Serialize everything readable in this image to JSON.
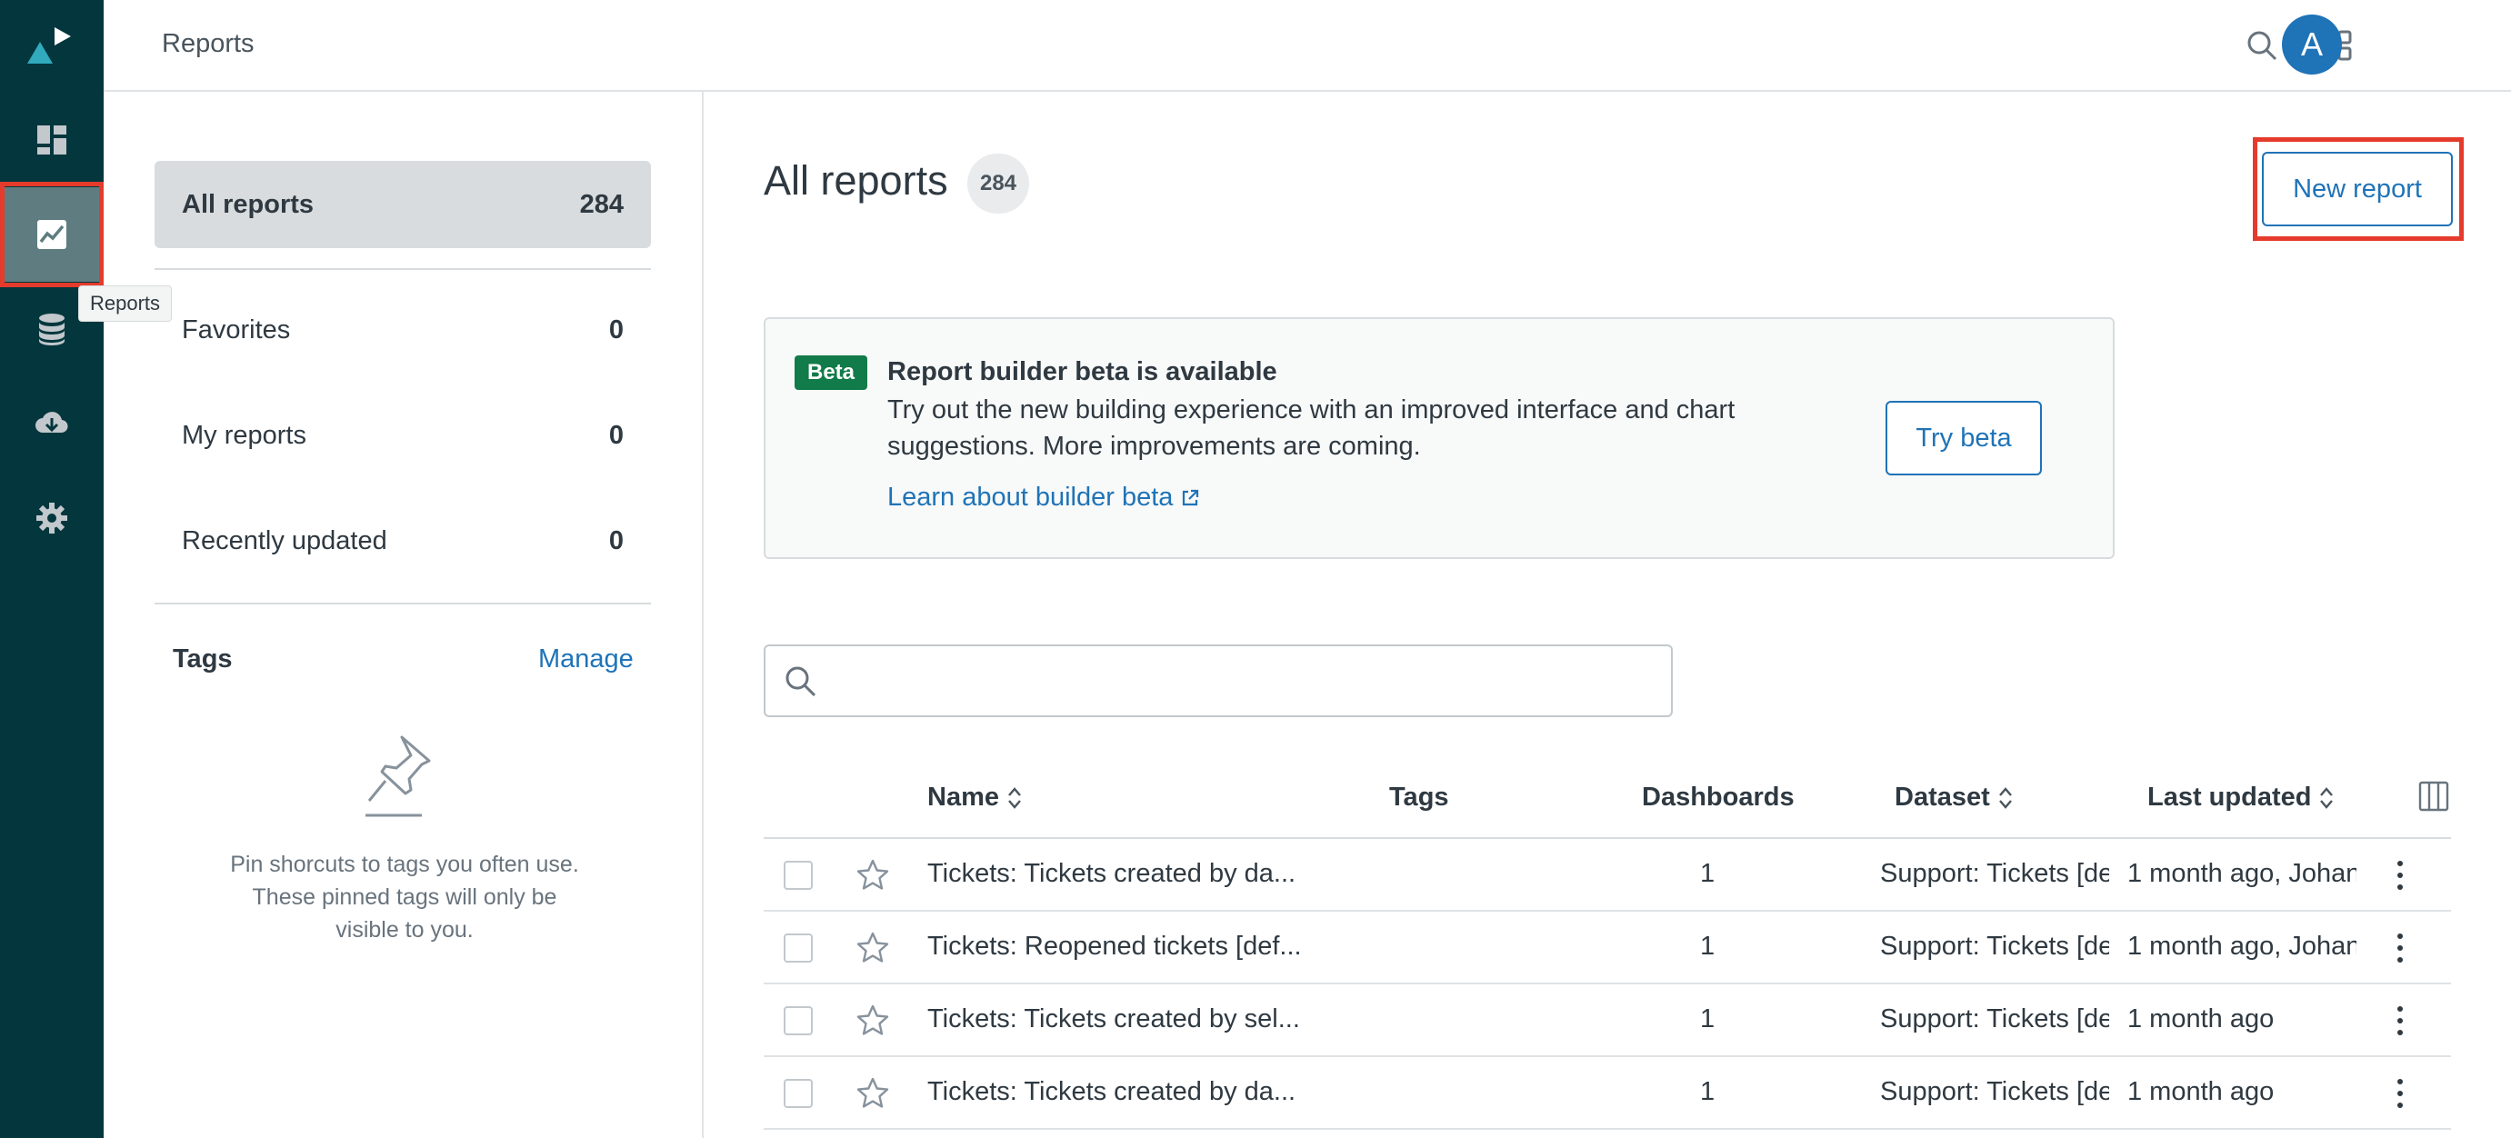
{
  "header": {
    "title": "Reports",
    "avatar_initial": "A"
  },
  "rail": {
    "tooltip": "Reports",
    "items": [
      {
        "icon": "dashboard-icon"
      },
      {
        "icon": "reports-icon",
        "active": true
      },
      {
        "icon": "datasets-icon"
      },
      {
        "icon": "download-icon"
      },
      {
        "icon": "gear-icon"
      }
    ]
  },
  "filters": {
    "all": {
      "label": "All reports",
      "count": "284"
    },
    "favorites": {
      "label": "Favorites",
      "count": "0"
    },
    "my": {
      "label": "My reports",
      "count": "0"
    },
    "recent": {
      "label": "Recently updated",
      "count": "0"
    }
  },
  "tags": {
    "title": "Tags",
    "manage": "Manage",
    "empty_text": "Pin shorcuts to tags you often use. These pinned tags will only be visible to you."
  },
  "main": {
    "title": "All reports",
    "count": "284",
    "new_report": "New report"
  },
  "beta": {
    "badge": "Beta",
    "heading": "Report builder beta is available",
    "body": "Try out the new building experience with an improved interface and chart suggestions. More improvements are coming.",
    "link": "Learn about builder beta",
    "button": "Try beta"
  },
  "search": {
    "placeholder": ""
  },
  "table": {
    "columns": {
      "name": "Name",
      "tags": "Tags",
      "dashboards": "Dashboards",
      "dataset": "Dataset",
      "last_updated": "Last updated"
    },
    "rows": [
      {
        "name": "Tickets: Tickets created by da...",
        "dashboards": "1",
        "dataset": "Support: Tickets [de",
        "updated": "1 month ago, Johan"
      },
      {
        "name": "Tickets: Reopened tickets [def...",
        "dashboards": "1",
        "dataset": "Support: Tickets [de",
        "updated": "1 month ago, Johan"
      },
      {
        "name": "Tickets: Tickets created by sel...",
        "dashboards": "1",
        "dataset": "Support: Tickets [de",
        "updated": "1 month ago"
      },
      {
        "name": "Tickets: Tickets created by da...",
        "dashboards": "1",
        "dataset": "Support: Tickets [de",
        "updated": "1 month ago"
      }
    ]
  },
  "colors": {
    "rail": "#03363d",
    "accent": "#1f73b7",
    "beta_badge": "#117b49",
    "highlight": "#e53b2c"
  }
}
